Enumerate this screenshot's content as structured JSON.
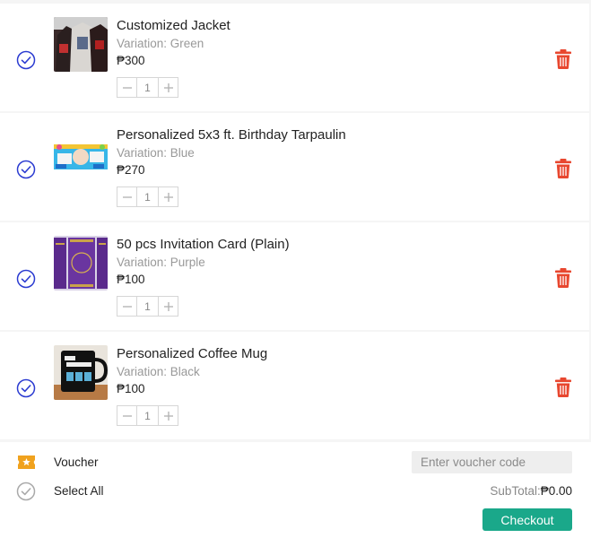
{
  "cart": {
    "items": [
      {
        "name": "Customized Jacket",
        "variation": "Variation: Green",
        "price": "₱300",
        "quantity": "1",
        "thumb_icon": "jacket-image",
        "selected": true
      },
      {
        "name": "Personalized 5x3 ft. Birthday Tarpaulin",
        "variation": "Variation: Blue",
        "price": "₱270",
        "quantity": "1",
        "thumb_icon": "tarpaulin-image",
        "selected": true
      },
      {
        "name": "50 pcs Invitation Card (Plain)",
        "variation": "Variation: Purple",
        "price": "₱100",
        "quantity": "1",
        "thumb_icon": "invitation-card-image",
        "selected": true
      },
      {
        "name": "Personalized Coffee Mug",
        "variation": "Variation: Black",
        "price": "₱100",
        "quantity": "1",
        "thumb_icon": "coffee-mug-image",
        "selected": true
      }
    ]
  },
  "footer": {
    "voucher_label": "Voucher",
    "voucher_placeholder": "Enter voucher code",
    "select_all_label": "Select All",
    "subtotal_label": "SubTotal:",
    "subtotal_value": "₱0.00",
    "checkout_label": "Checkout"
  },
  "colors": {
    "check_blue": "#2b3bd1",
    "trash_red": "#e8472f",
    "checkout_green": "#1aa88a",
    "voucher_yellow": "#f0a21e"
  }
}
